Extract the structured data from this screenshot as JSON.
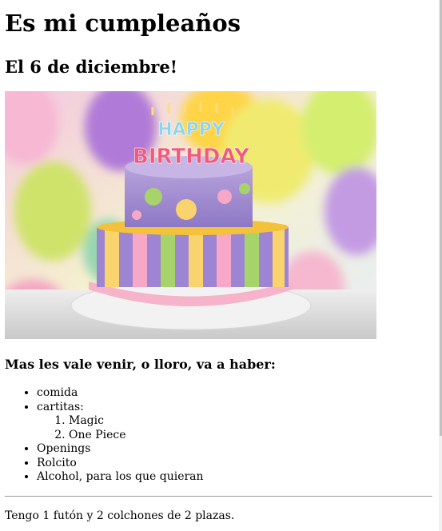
{
  "page": {
    "title": "Es mi cumpleaños",
    "subtitle": "El 6 de diciembre!",
    "image_alt": "HAPPY BIRTHDAY",
    "invite_heading": "Mas les vale venir, o lloro, va a haber:",
    "items": [
      {
        "label": "comida"
      },
      {
        "label": "cartitas:"
      },
      {
        "label": "Openings"
      },
      {
        "label": "Rolcito"
      },
      {
        "label": "Alcohol, para los que quieran"
      }
    ],
    "subitems": [
      {
        "label": "Magic"
      },
      {
        "label": "One Piece"
      }
    ],
    "footer_note": "Tengo 1 futón y 2 colchones de 2 plazas."
  },
  "colors": {
    "background": "#ffffff",
    "text": "#000000",
    "separator": "#9a9a9a"
  }
}
